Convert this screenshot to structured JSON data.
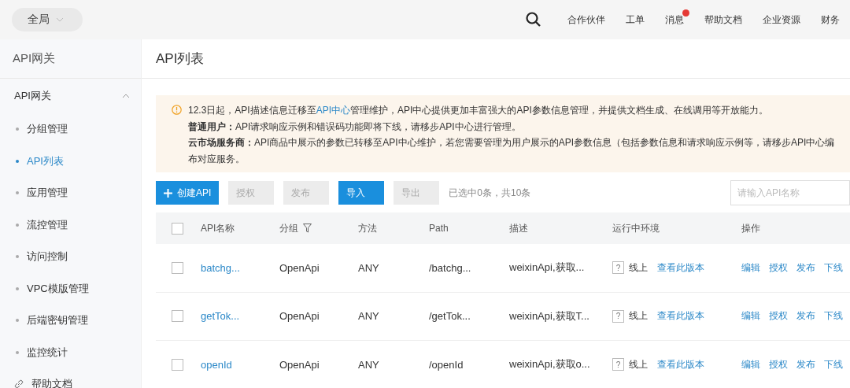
{
  "topbar": {
    "scope": {
      "label": "全局"
    },
    "nav": [
      {
        "label": "合作伙伴",
        "badge": false
      },
      {
        "label": "工单",
        "badge": false
      },
      {
        "label": "消息",
        "badge": true
      },
      {
        "label": "帮助文档",
        "badge": false
      },
      {
        "label": "企业资源",
        "badge": false
      },
      {
        "label": "财务",
        "badge": false
      }
    ]
  },
  "sidebar": {
    "title": "API网关",
    "group": {
      "label": "API网关",
      "expanded": true
    },
    "items": [
      {
        "label": "分组管理",
        "selected": false
      },
      {
        "label": "API列表",
        "selected": true
      },
      {
        "label": "应用管理",
        "selected": false
      },
      {
        "label": "流控管理",
        "selected": false
      },
      {
        "label": "访问控制",
        "selected": false
      },
      {
        "label": "VPC模版管理",
        "selected": false
      },
      {
        "label": "后端密钥管理",
        "selected": false
      },
      {
        "label": "监控统计",
        "selected": false
      }
    ],
    "help": {
      "label": "帮助文档"
    }
  },
  "page": {
    "title": "API列表"
  },
  "notice": {
    "line1_before": "12.3日起，API描述信息迁移至",
    "line1_link": "API中心",
    "line1_after": "管理维护，API中心提供更加丰富强大的API参数信息管理，并提供文档生成、在线调用等开放能力。",
    "lines": [
      "**普通用户：**API请求响应示例和错误码功能即将下线，请移步API中心进行管理。",
      "**云市场服务商：**API商品中展示的参数已转移至API中心维护，若您需要管理为用户展示的API参数信息（包括参数信息和请求响应示例等，请移步API中心编",
      "布对应服务。"
    ]
  },
  "toolbar": {
    "buttons": [
      {
        "label": "创建API",
        "kind": "create",
        "disabled": false
      },
      {
        "label": "授权",
        "kind": "plain",
        "disabled": true
      },
      {
        "label": "发布",
        "kind": "plain",
        "disabled": true
      },
      {
        "label": "导入",
        "kind": "plain",
        "disabled": false
      },
      {
        "label": "导出",
        "kind": "plain",
        "disabled": true
      }
    ],
    "selection": "已选中0条，共10条",
    "search": {
      "placeholder": "请输入API名称"
    }
  },
  "table": {
    "select_all": {
      "checked": false
    },
    "columns": [
      "API名称",
      "分组",
      "方法",
      "Path",
      "描述",
      "运行中环境",
      "操作"
    ],
    "rows": [
      {
        "checked": false,
        "name": "batchg...",
        "group": "OpenApi",
        "method": "ANY",
        "path": "/batchg...",
        "description": "weixinApi,获取...",
        "env_help": "?",
        "env": "线上",
        "version_link": "查看此版本",
        "actions": [
          "编辑",
          "授权",
          "发布",
          "下线"
        ]
      },
      {
        "checked": false,
        "name": "getTok...",
        "group": "OpenApi",
        "method": "ANY",
        "path": "/getTok...",
        "description": "weixinApi,获取T...",
        "env_help": "?",
        "env": "线上",
        "version_link": "查看此版本",
        "actions": [
          "编辑",
          "授权",
          "发布",
          "下线"
        ]
      },
      {
        "checked": false,
        "name": "openId",
        "group": "OpenApi",
        "method": "ANY",
        "path": "/openId",
        "description": "weixinApi,获取o...",
        "env_help": "?",
        "env": "线上",
        "version_link": "查看此版本",
        "actions": [
          "编辑",
          "授权",
          "发布",
          "下线"
        ]
      }
    ]
  }
}
